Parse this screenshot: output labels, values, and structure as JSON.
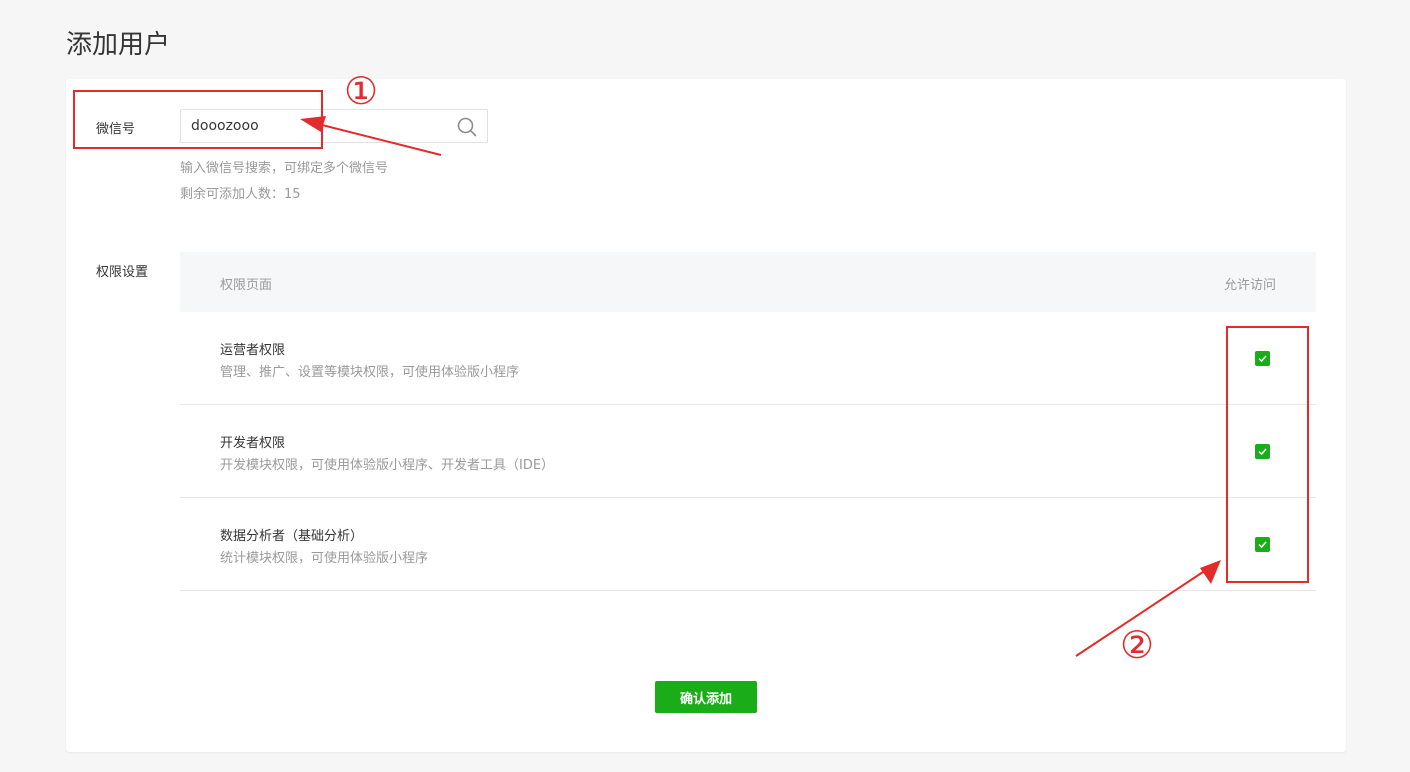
{
  "page": {
    "title": "添加用户"
  },
  "wechat_field": {
    "label": "微信号",
    "value": "dooozooo",
    "hint": "输入微信号搜索，可绑定多个微信号",
    "remaining": "剩余可添加人数：15"
  },
  "permissions": {
    "label": "权限设置",
    "header_page": "权限页面",
    "header_access": "允许访问",
    "rows": [
      {
        "title": "运营者权限",
        "desc": "管理、推广、设置等模块权限，可使用体验版小程序",
        "checked": true
      },
      {
        "title": "开发者权限",
        "desc": "开发模块权限，可使用体验版小程序、开发者工具（IDE）",
        "checked": true
      },
      {
        "title": "数据分析者（基础分析）",
        "desc": "统计模块权限，可使用体验版小程序",
        "checked": true
      }
    ]
  },
  "actions": {
    "confirm_label": "确认添加"
  },
  "annotations": {
    "marker_1": "①",
    "marker_2": "②",
    "color": "#e22b2b"
  },
  "colors": {
    "accent": "#1aad19",
    "background": "#f6f6f6"
  }
}
